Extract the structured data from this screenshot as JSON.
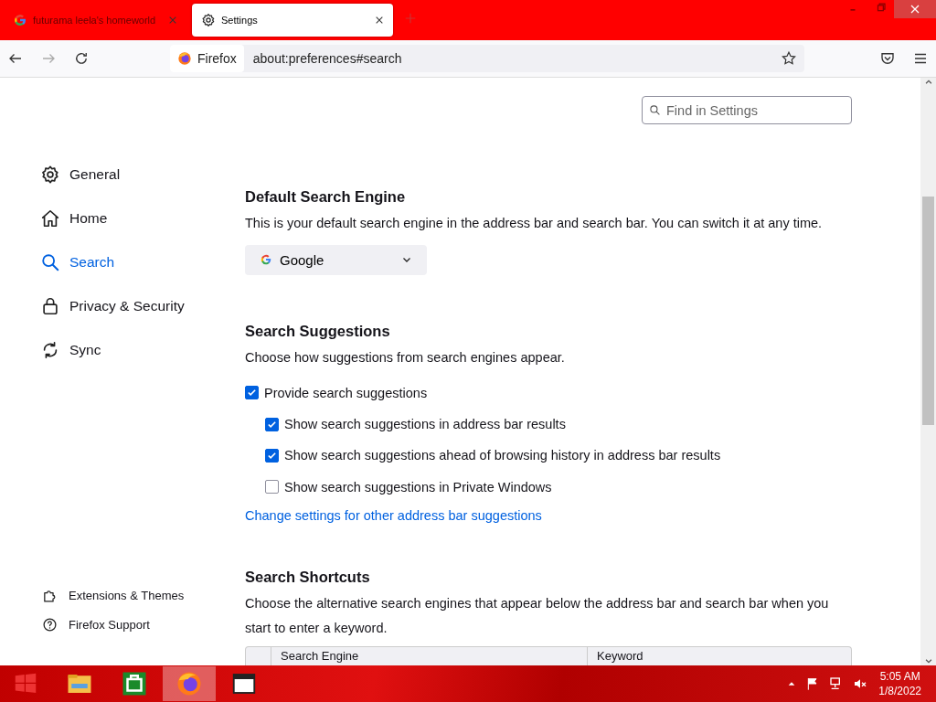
{
  "tabs": [
    {
      "title": "futurama leela's homeworld",
      "kind": "google",
      "selected": false
    },
    {
      "title": "Settings",
      "kind": "settings",
      "selected": true
    }
  ],
  "toolbar": {
    "identity": "Firefox",
    "url": "about:preferences#search"
  },
  "find": {
    "placeholder": "Find in Settings"
  },
  "sidebar": {
    "items": [
      {
        "label": "General",
        "selected": false
      },
      {
        "label": "Home",
        "selected": false
      },
      {
        "label": "Search",
        "selected": true
      },
      {
        "label": "Privacy & Security",
        "selected": false
      },
      {
        "label": "Sync",
        "selected": false
      }
    ],
    "footer": [
      {
        "label": "Extensions & Themes"
      },
      {
        "label": "Firefox Support"
      }
    ]
  },
  "default_engine": {
    "heading": "Default Search Engine",
    "description": "This is your default search engine in the address bar and search bar. You can switch it at any time.",
    "engine": "Google"
  },
  "suggestions": {
    "heading": "Search Suggestions",
    "description": "Choose how suggestions from search engines appear.",
    "options": [
      {
        "label": "Provide search suggestions",
        "checked": true,
        "children": [
          {
            "label": "Show search suggestions in address bar results",
            "checked": true
          },
          {
            "label": "Show search suggestions ahead of browsing history in address bar results",
            "checked": true
          },
          {
            "label": "Show search suggestions in Private Windows",
            "checked": false
          }
        ]
      }
    ],
    "link": "Change settings for other address bar suggestions"
  },
  "shortcuts": {
    "heading": "Search Shortcuts",
    "description": "Choose the alternative search engines that appear below the address bar and search bar when you start to enter a keyword.",
    "columns": [
      "Search Engine",
      "Keyword"
    ]
  },
  "taskbar": {
    "apps": [
      {
        "kind": "explorer",
        "active": false
      },
      {
        "kind": "store",
        "active": false
      },
      {
        "kind": "firefox",
        "active": true
      },
      {
        "kind": "window",
        "active": false
      }
    ],
    "time": "5:05 AM",
    "date": "1/8/2022"
  }
}
